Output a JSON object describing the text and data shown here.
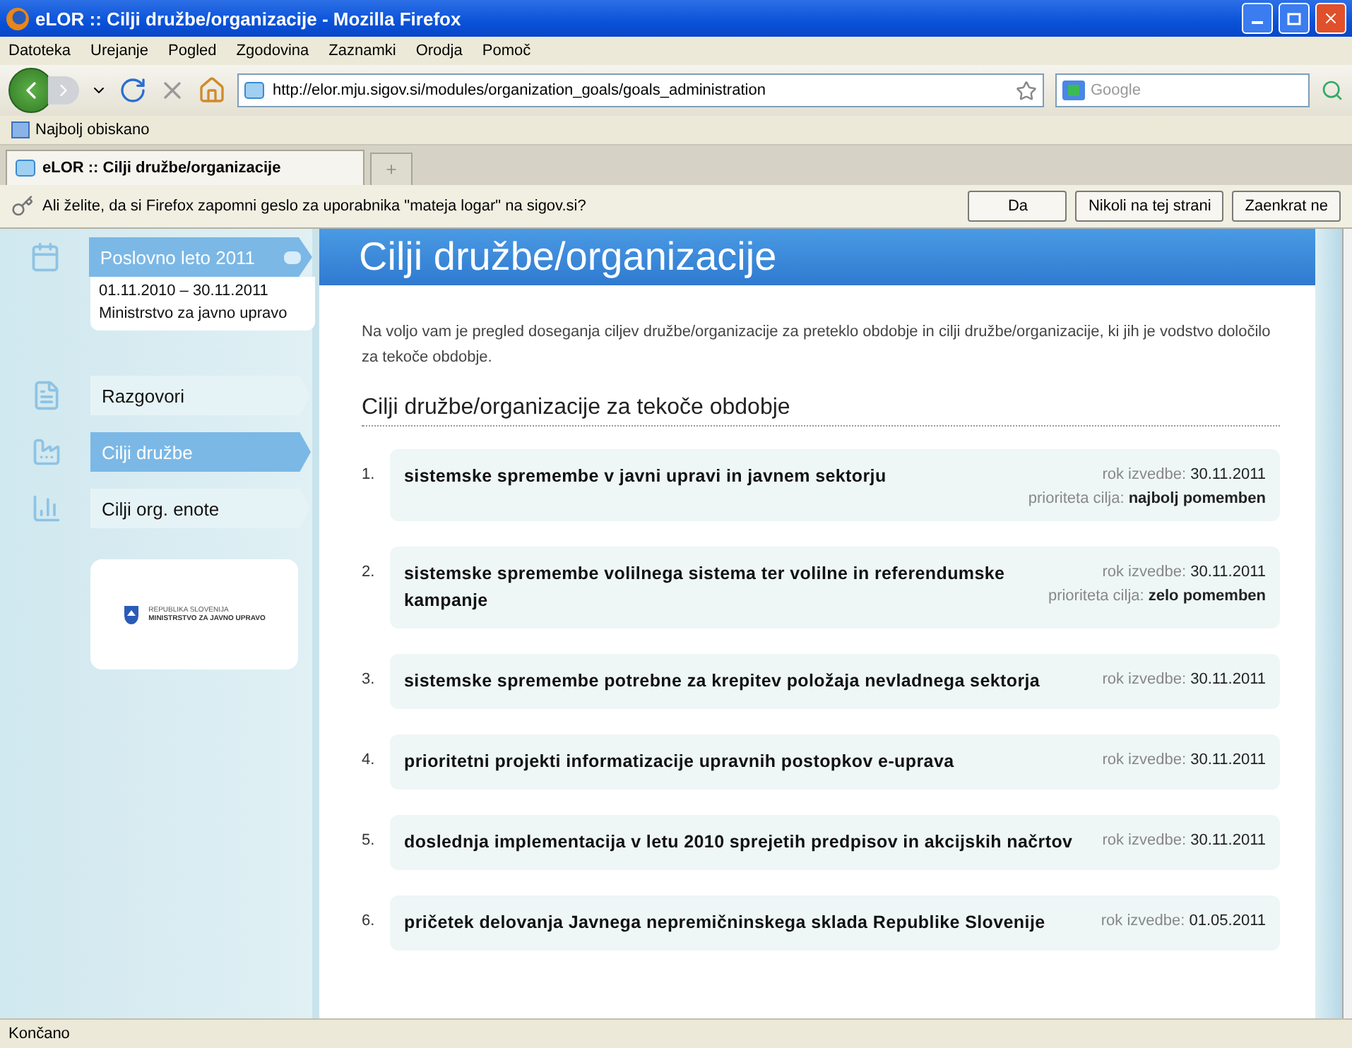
{
  "window": {
    "title": "eLOR :: Cilji družbe/organizacije - Mozilla Firefox"
  },
  "menu": [
    "Datoteka",
    "Urejanje",
    "Pogled",
    "Zgodovina",
    "Zaznamki",
    "Orodja",
    "Pomoč"
  ],
  "address": {
    "value": "http://elor.mju.sigov.si/modules/organization_goals/goals_administration"
  },
  "search": {
    "placeholder": "Google"
  },
  "bookmarks": [
    "Najbolj obiskano"
  ],
  "tabs": [
    {
      "label": "eLOR :: Cilji družbe/organizacije",
      "selected": true
    }
  ],
  "notification": {
    "text": "Ali želite, da si Firefox zapomni geslo za uporabnika \"mateja logar\" na sigov.si?",
    "buttons": [
      "Da",
      "Nikoli na tej strani",
      "Zaenkrat ne"
    ]
  },
  "sidebar": {
    "year": {
      "title": "Poslovno leto 2011",
      "period": "01.11.2010 – 30.11.2011",
      "organization": "Ministrstvo za javno upravo"
    },
    "items": [
      {
        "label": "Razgovori",
        "kind": "document",
        "selected": false
      },
      {
        "label": "Cilji družbe",
        "kind": "factory",
        "selected": true
      },
      {
        "label": "Cilji org. enote",
        "kind": "chart",
        "selected": false
      }
    ],
    "logo": {
      "line1": "REPUBLIKA SLOVENIJA",
      "line2": "MINISTRSTVO ZA JAVNO UPRAVO"
    }
  },
  "page": {
    "title": "Cilji družbe/organizacije",
    "intro": "Na voljo vam je pregled doseganja ciljev družbe/organizacije za preteklo obdobje in cilji družbe/organizacije, ki jih je vodstvo določilo za tekoče obdobje.",
    "section": "Cilji družbe/organizacije za tekoče obdobje"
  },
  "goals": [
    {
      "number": "1.",
      "title": "sistemske spremembe v javni upravi in javnem sektorju",
      "deadline_label": "rok izvedbe:",
      "deadline": "30.11.2011",
      "priority_label": "prioriteta cilja:",
      "priority": "najbolj pomemben"
    },
    {
      "number": "2.",
      "title": "sistemske spremembe volilnega sistema ter volilne in referendumske kampanje",
      "deadline_label": "rok izvedbe:",
      "deadline": "30.11.2011",
      "priority_label": "prioriteta cilja:",
      "priority": "zelo pomemben"
    },
    {
      "number": "3.",
      "title": "sistemske spremembe potrebne za krepitev položaja nevladnega sektorja",
      "deadline_label": "rok izvedbe:",
      "deadline": "30.11.2011"
    },
    {
      "number": "4.",
      "title": "prioritetni projekti informatizacije upravnih postopkov e-uprava",
      "deadline_label": "rok izvedbe:",
      "deadline": "30.11.2011"
    },
    {
      "number": "5.",
      "title": "doslednja implementacija v letu 2010 sprejetih predpisov in akcijskih načrtov",
      "deadline_label": "rok izvedbe:",
      "deadline": "30.11.2011"
    },
    {
      "number": "6.",
      "title": "pričetek delovanja Javnega nepremičninskega sklada Republike Slovenije",
      "deadline_label": "rok izvedbe:",
      "deadline": "01.05.2011"
    }
  ],
  "status_bar": {
    "text": "Končano"
  }
}
